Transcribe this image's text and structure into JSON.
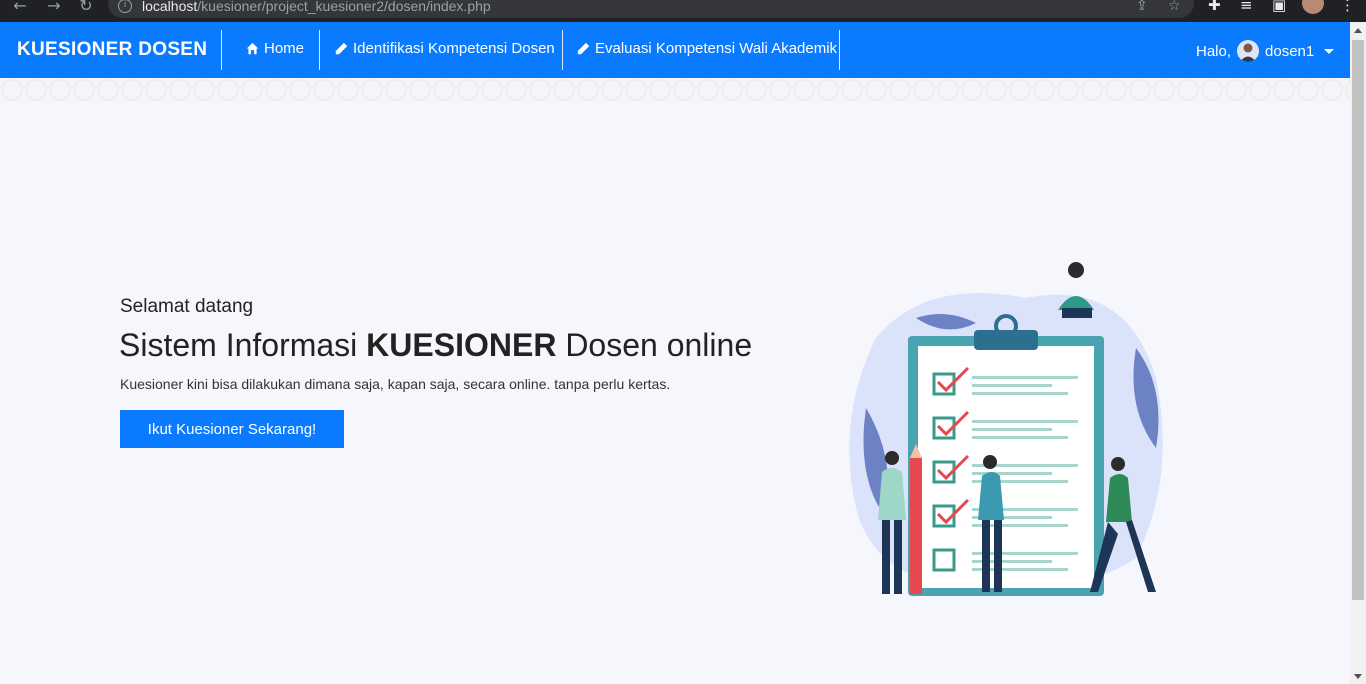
{
  "browser": {
    "url_host": "localhost",
    "url_path": "/kuesioner/project_kuesioner2/dosen/index.php"
  },
  "navbar": {
    "brand": "KUESIONER DOSEN",
    "items": [
      {
        "label": "Home",
        "icon": "home-icon"
      },
      {
        "label": "Identifikasi Kompetensi Dosen",
        "icon": "pencil-icon"
      },
      {
        "label": "Evaluasi Kompetensi Wali Akademik",
        "icon": "pencil-icon"
      }
    ],
    "greeting": "Halo,",
    "username": "dosen1",
    "accent": "#0a7bff"
  },
  "hero": {
    "greeting": "Selamat datang",
    "title_prefix": "Sistem Informasi",
    "title_bold": "KUESIONER",
    "title_suffix": "Dosen online",
    "description": "Kuesioner kini bisa dilakukan dimana saja, kapan saja, secara online. tanpa perlu kertas.",
    "cta_label": "Ikut Kuesioner Sekarang!"
  }
}
